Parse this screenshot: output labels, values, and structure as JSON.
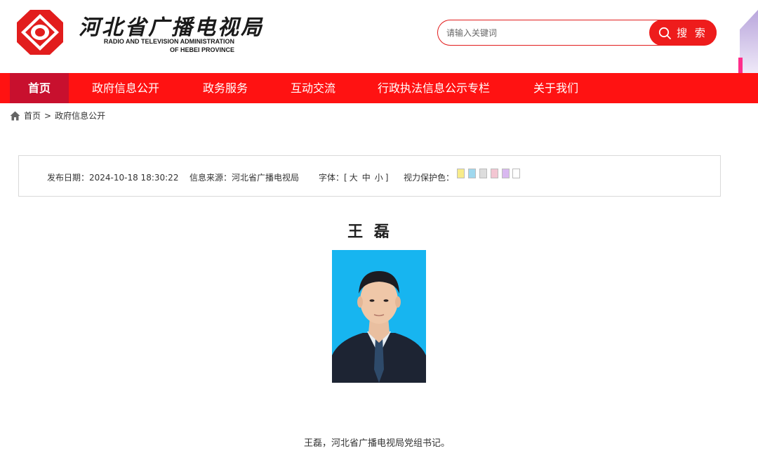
{
  "header": {
    "brand_cn": "河北省广播电视局",
    "brand_en_line1": "RADIO AND TELEVISION ADMINISTRATION",
    "brand_en_line2": "OF HEBEI PROVINCE"
  },
  "search": {
    "placeholder": "请输入关键词",
    "button_label": "搜 索"
  },
  "nav": {
    "items": [
      {
        "label": "首页"
      },
      {
        "label": "政府信息公开"
      },
      {
        "label": "政务服务"
      },
      {
        "label": "互动交流"
      },
      {
        "label": "行政执法信息公示专栏"
      },
      {
        "label": "关于我们"
      }
    ]
  },
  "breadcrumb": {
    "home": "首页",
    "separator": ">",
    "current": "政府信息公开"
  },
  "info": {
    "publish_date": "发布日期：2024-10-18 18:30:22",
    "source": "信息来源：河北省广播电视局",
    "font_label": "字体：[",
    "font_large": "大",
    "font_medium": "中",
    "font_small": "小",
    "font_close": "]",
    "eye_label": "视力保护色：",
    "swatches": [
      "#f8ec8a",
      "#9fd8ee",
      "#dddddd",
      "#f3c6d2",
      "#d9b8f0",
      "#ffffff"
    ]
  },
  "article": {
    "title": "王 磊",
    "bio": "王磊，河北省广播电视局党组书记。"
  },
  "colors": {
    "nav_bg": "#ff1212",
    "nav_active": "#c8102e",
    "search_btn": "#ee1c1c"
  }
}
